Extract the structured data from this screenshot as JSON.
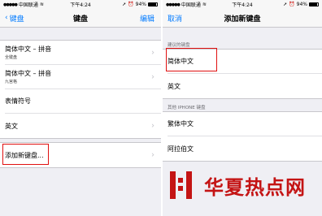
{
  "status_left": {
    "carrier": "中国联通",
    "time": "下午4:24",
    "battery": "94%"
  },
  "status_right": {
    "carrier": "中国联通",
    "time": "下午4:24",
    "battery": "94%"
  },
  "left_screen": {
    "back_label": "键盘",
    "title": "键盘",
    "edit_label": "编辑",
    "keyboards": [
      {
        "name": "简体中文 – 拼音",
        "sub": "全键盘"
      },
      {
        "name": "简体中文 – 拼音",
        "sub": "九宫格"
      },
      {
        "name": "表情符号",
        "sub": ""
      },
      {
        "name": "英文",
        "sub": ""
      }
    ],
    "add_label": "添加新键盘..."
  },
  "right_screen": {
    "cancel_label": "取消",
    "title": "添加新键盘",
    "suggested_header": "建议的键盘",
    "suggested": [
      "简体中文",
      "英文"
    ],
    "other_header": "其他 IPHONE 键盘",
    "other": [
      "繁体中文",
      "阿拉伯文"
    ]
  },
  "watermark": {
    "text": "华夏热点网"
  },
  "colors": {
    "accent": "#007aff",
    "highlight": "#e01010",
    "watermark": "#c41414"
  }
}
